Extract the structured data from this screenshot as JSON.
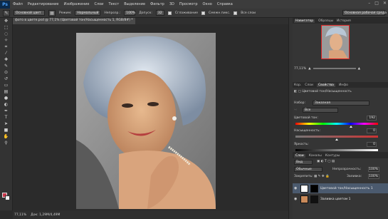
{
  "app": {
    "logo": "Ps",
    "menu": [
      "Файл",
      "Редактирование",
      "Изображение",
      "Слои",
      "Текст",
      "Выделение",
      "Фильтр",
      "3D",
      "Просмотр",
      "Окно",
      "Справка"
    ],
    "window_controls": [
      "–",
      "□",
      "✕"
    ]
  },
  "options_bar": {
    "tool_preset_icon": "brush-tool-icon",
    "source_label": "Основной цвет",
    "mode_label": "Режим:",
    "mode_value": "Нормальный",
    "opacity_label": "Непрозр.:",
    "opacity_value": "100%",
    "tolerance_label": "Допуск:",
    "tolerance_value": "32",
    "antialias_label": "Сглаживание",
    "contiguous_label": "Смежн.пикс.",
    "all_layers_label": "Все слои",
    "workspace_value": "Основная рабочая среда"
  },
  "document": {
    "tab_title": "фото в цвете.psd @ 77,1% (Цветовой тон/Насыщенность 1, RGB/8#) *",
    "status_zoom": "77,11%",
    "status_doc": "Док: 1,29M/4,49M"
  },
  "tools": [
    "move",
    "marquee",
    "lasso",
    "quick-select",
    "crop",
    "eyedropper",
    "healing",
    "brush",
    "clone",
    "history",
    "eraser",
    "gradient",
    "blur",
    "dodge",
    "pen",
    "text",
    "path-select",
    "shape",
    "hand",
    "zoom"
  ],
  "colors": {
    "foreground": "#c9384b",
    "background": "#f2f2f2",
    "accent": "#4ea3ff"
  },
  "navigator": {
    "tabs": [
      "Навигатор",
      "Образцы",
      "История"
    ],
    "zoom_value": "77,11%"
  },
  "properties": {
    "tabs": [
      "Кор.",
      "Слои",
      "Свойства",
      "Инфо"
    ],
    "header": "Цветовой тон/Насыщенность",
    "preset_label": "Набор:",
    "preset_value": "Заказная",
    "channel_value": "Все",
    "hue_label": "Цветовой тон:",
    "hue_value": "192",
    "saturation_label": "Насыщенность:",
    "saturation_value": "0",
    "lightness_label": "Яркость:",
    "lightness_value": "0"
  },
  "layers": {
    "tabs": [
      "Слои",
      "Каналы",
      "Контуры"
    ],
    "kind_label": "Вид",
    "blend_value": "Обычные",
    "opacity_label": "Непрозрачность:",
    "opacity_value": "100%",
    "lock_label": "Закрепить:",
    "fill_label": "Заливка:",
    "fill_value": "100%",
    "items": [
      {
        "name": "Цветовой тон/Насыщенность 1"
      },
      {
        "name": "Заливка цветом 1"
      }
    ]
  }
}
